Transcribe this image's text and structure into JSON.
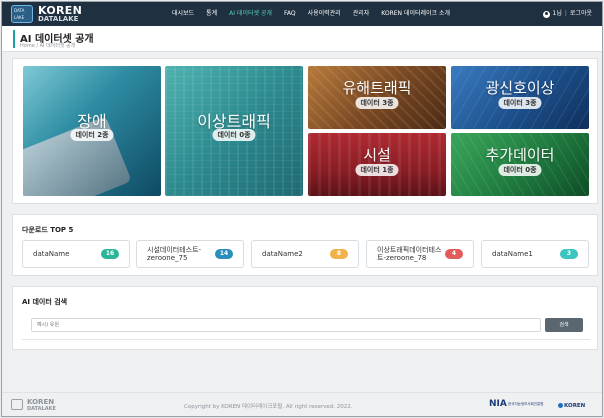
{
  "brand": {
    "badge_top": "DATA",
    "badge_bottom": "LAKE",
    "name": "KOREN",
    "sub": "DATALAKE"
  },
  "nav": [
    {
      "label": "대시보드",
      "active": false
    },
    {
      "label": "통계",
      "active": false
    },
    {
      "label": "AI 데이터셋 공개",
      "active": true
    },
    {
      "label": "FAQ",
      "active": false
    },
    {
      "label": "사용이력관리",
      "active": false
    },
    {
      "label": "관리자",
      "active": false
    },
    {
      "label": "KOREN 데이터레이크 소개",
      "active": false
    }
  ],
  "user": {
    "name": "1님",
    "separator": "|",
    "logout": "로그아웃"
  },
  "page": {
    "title": "AI 데이터셋 공개",
    "breadcrumb": "Home  /  AI 데이터셋 공개"
  },
  "categories": [
    {
      "title": "장애",
      "badge": "데이터 2종"
    },
    {
      "title": "이상트래픽",
      "badge": "데이터 0종"
    },
    {
      "title": "유해트래픽",
      "badge": "데이터 3종"
    },
    {
      "title": "광신호이상",
      "badge": "데이터 3종"
    },
    {
      "title": "시설",
      "badge": "데이터 1종"
    },
    {
      "title": "추가데이터",
      "badge": "데이터 0종"
    }
  ],
  "downloads": {
    "title": "다운로드 TOP 5",
    "items": [
      {
        "name": "dataName",
        "count": "16",
        "color": "#2bb59a"
      },
      {
        "name": "시설데이터테스트-zeroone_75",
        "count": "14",
        "color": "#2a8fbd"
      },
      {
        "name": "dataName2",
        "count": "8",
        "color": "#f0b24a"
      },
      {
        "name": "이상트래픽데이터테스트-zeroone_78",
        "count": "4",
        "color": "#e25c5c"
      },
      {
        "name": "dataName1",
        "count": "3",
        "color": "#3cc4c0"
      }
    ]
  },
  "search": {
    "title": "AI 데이터 검색",
    "placeholder": "예시) 유원",
    "button": "검색"
  },
  "footer": {
    "logo_name": "KOREN",
    "logo_sub": "DATALAKE",
    "copyright": "Copyright by KOREN 데이터레이크포털. All right reserved. 2022.",
    "nia": "NIA",
    "nia_sub": "한국지능정보사회진흥원",
    "koren": "KOREN"
  }
}
